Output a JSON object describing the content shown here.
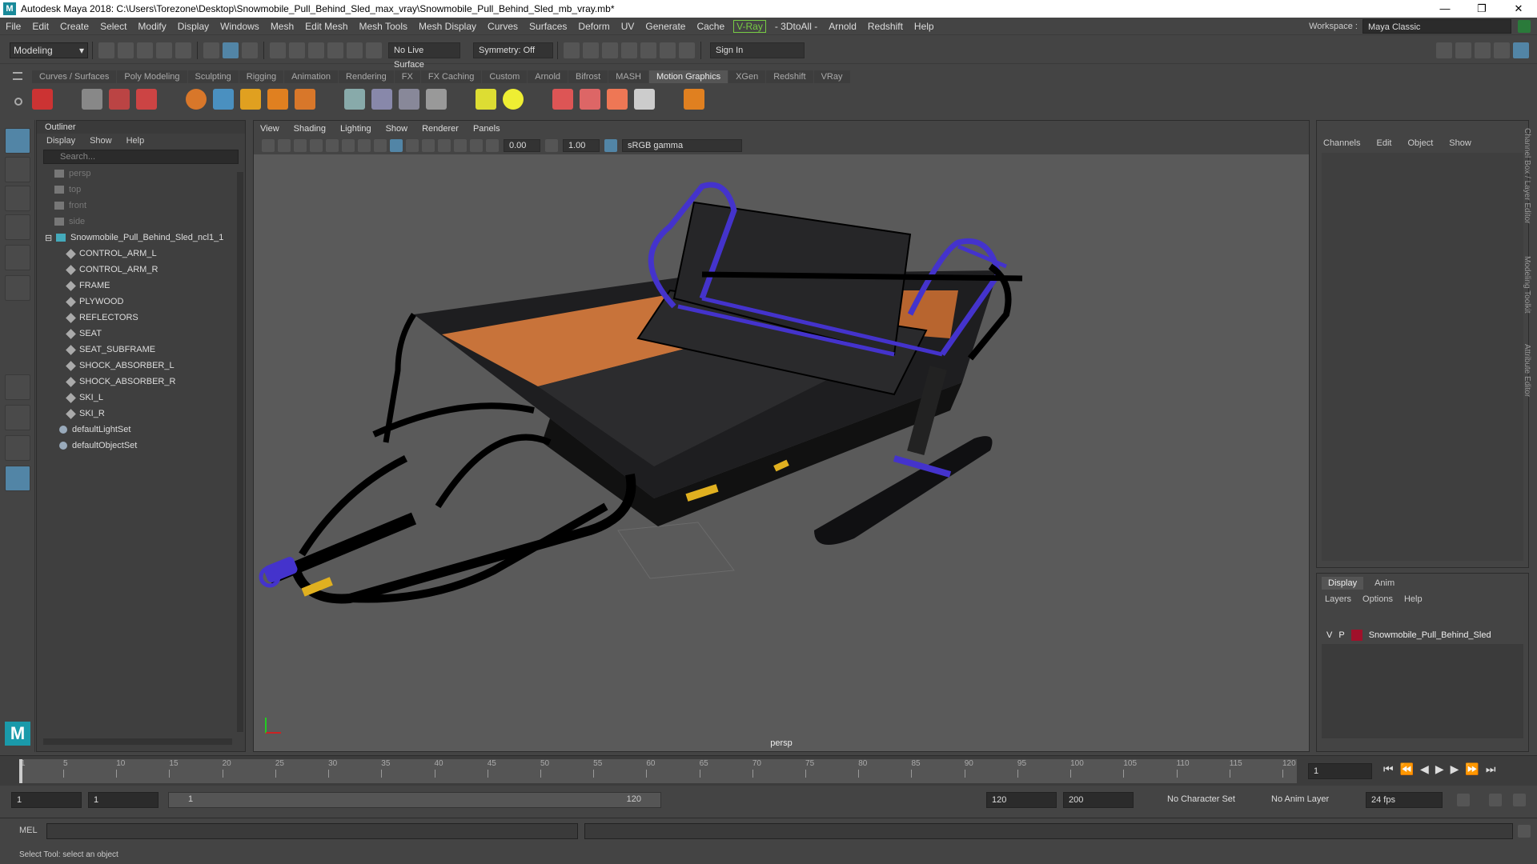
{
  "window": {
    "title": "Autodesk Maya 2018: C:\\Users\\Torezone\\Desktop\\Snowmobile_Pull_Behind_Sled_max_vray\\Snowmobile_Pull_Behind_Sled_mb_vray.mb*",
    "logo": "M",
    "minimize": "—",
    "restore": "❐",
    "close": "✕"
  },
  "menubar": {
    "items": [
      "File",
      "Edit",
      "Create",
      "Select",
      "Modify",
      "Display",
      "Windows",
      "Mesh",
      "Edit Mesh",
      "Mesh Tools",
      "Mesh Display",
      "Curves",
      "Surfaces",
      "Deform",
      "UV",
      "Generate",
      "Cache"
    ],
    "vray": "V-Ray",
    "items2": [
      "- 3DtoAll -",
      "Arnold",
      "Redshift",
      "Help"
    ],
    "workspace_label": "Workspace :",
    "workspace_value": "Maya Classic"
  },
  "statusline": {
    "mode": "Modeling",
    "live_surface": "No Live Surface",
    "symmetry": "Symmetry: Off",
    "sign_in": "Sign In"
  },
  "shelf": {
    "tabs": [
      "Curves / Surfaces",
      "Poly Modeling",
      "Sculpting",
      "Rigging",
      "Animation",
      "Rendering",
      "FX",
      "FX Caching",
      "Custom",
      "Arnold",
      "Bifrost",
      "MASH",
      "Motion Graphics",
      "XGen",
      "Redshift",
      "VRay"
    ],
    "active_tab": "Motion Graphics"
  },
  "outliner": {
    "title": "Outliner",
    "menus": [
      "Display",
      "Show",
      "Help"
    ],
    "search_placeholder": "Search...",
    "cameras": [
      "persp",
      "top",
      "front",
      "side"
    ],
    "root": "Snowmobile_Pull_Behind_Sled_ncl1_1",
    "children": [
      "CONTROL_ARM_L",
      "CONTROL_ARM_R",
      "FRAME",
      "PLYWOOD",
      "REFLECTORS",
      "SEAT",
      "SEAT_SUBFRAME",
      "SHOCK_ABSORBER_L",
      "SHOCK_ABSORBER_R",
      "SKI_L",
      "SKI_R"
    ],
    "sets": [
      "defaultLightSet",
      "defaultObjectSet"
    ]
  },
  "viewport": {
    "menus": [
      "View",
      "Shading",
      "Lighting",
      "Show",
      "Renderer",
      "Panels"
    ],
    "near": "0.00",
    "far": "1.00",
    "colorspace": "sRGB gamma",
    "camera_label": "persp"
  },
  "channelbox": {
    "menus": [
      "Channels",
      "Edit",
      "Object",
      "Show"
    ],
    "side_tabs": [
      "Channel Box / Layer Editor",
      "Modeling Toolkit",
      "Attribute Editor"
    ]
  },
  "layers": {
    "tabs": [
      "Display",
      "Anim"
    ],
    "active_tab": "Display",
    "menus": [
      "Layers",
      "Options",
      "Help"
    ],
    "layer": {
      "v": "V",
      "p": "P",
      "name": "Snowmobile_Pull_Behind_Sled",
      "color": "#a0102a"
    }
  },
  "timeline": {
    "ticks": [
      1,
      5,
      10,
      15,
      20,
      25,
      30,
      35,
      40,
      45,
      50,
      55,
      60,
      65,
      70,
      75,
      80,
      85,
      90,
      95,
      100,
      105,
      110,
      115,
      120
    ],
    "current_frame": "1"
  },
  "range": {
    "start": "1",
    "playback_start": "1",
    "slider_start": "1",
    "slider_end": "120",
    "playback_end": "120",
    "end": "200",
    "character_set": "No Character Set",
    "anim_layer": "No Anim Layer",
    "fps": "24 fps"
  },
  "cmdline": {
    "label": "MEL"
  },
  "helpline": {
    "text": "Select Tool: select an object"
  },
  "colors": {
    "accent": "#5285a6",
    "selection_blue": "#4433cc",
    "panel_bg": "#444444",
    "viewport_bg": "#5a5a5a"
  }
}
